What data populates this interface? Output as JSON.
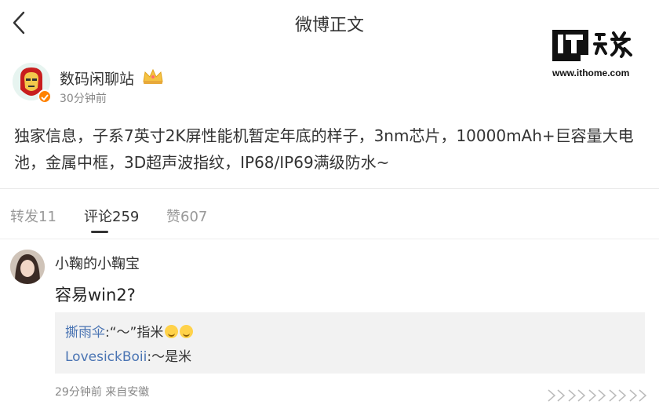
{
  "topbar": {
    "title": "微博正文",
    "back_icon": "chevron-left-icon"
  },
  "watermark": {
    "logo_text": "IT之家",
    "domain": "www.ithome.com"
  },
  "post": {
    "user_name": "数码闲聊站",
    "time": "30分钟前",
    "text": "独家信息，子系7英寸2K屏性能机暂定年底的样子，3nm芯片，10000mAh+巨容量大电池，金属中框，3D超声波指纹，IP68/IP69满级防水~",
    "verified_color": "#ff8200"
  },
  "tabs": [
    {
      "label": "转发11"
    },
    {
      "label": "评论259"
    },
    {
      "label": "赞607"
    }
  ],
  "comment": {
    "user_name": "小鞠的小鞠宝",
    "text": "容易win2?",
    "replies": [
      {
        "user": "撕雨伞",
        "text": ":“〜”指米"
      },
      {
        "user": "LovesickBoii",
        "text": ":〜是米"
      }
    ],
    "meta": "29分钟前 来自安徽"
  },
  "colors": {
    "link": "#4a74b3",
    "reply_bg": "#f2f2f2"
  }
}
